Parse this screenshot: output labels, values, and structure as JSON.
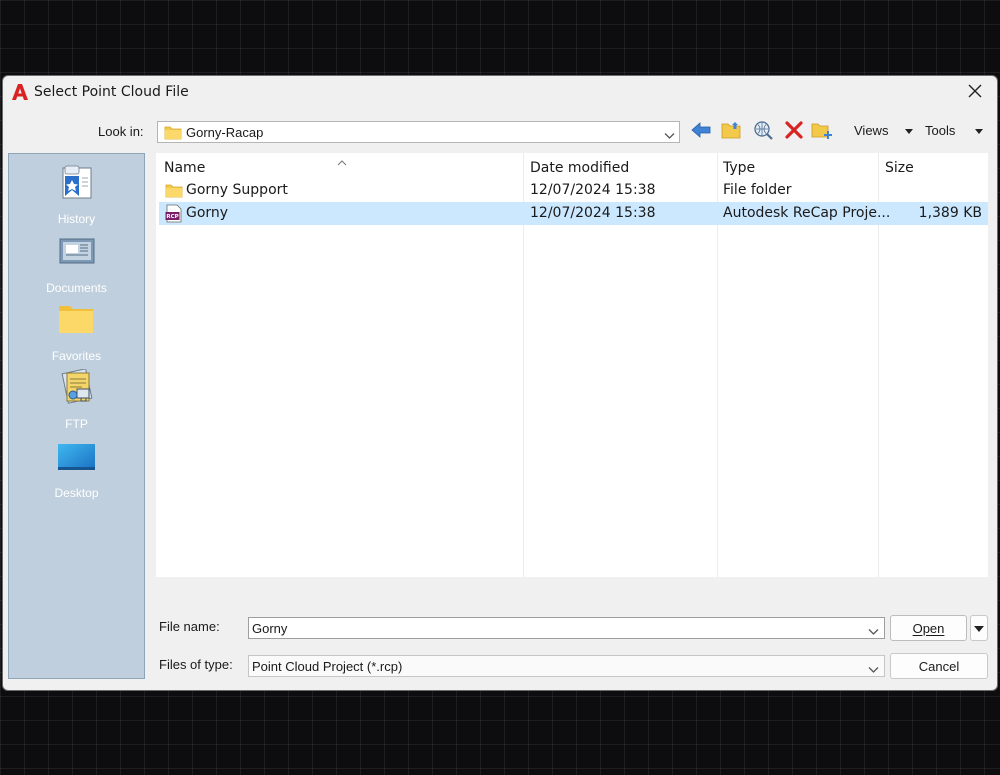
{
  "dialog": {
    "title": "Select Point Cloud File",
    "app_icon": "autocad-logo-icon",
    "close_icon": "close-icon"
  },
  "toolbar": {
    "look_in_label": "Look in:",
    "look_in_value": "Gorny-Racap",
    "icons": [
      "back-arrow-icon",
      "up-folder-icon",
      "search-web-icon",
      "delete-icon",
      "new-folder-icon"
    ],
    "views_label": "Views",
    "tools_label": "Tools"
  },
  "places": [
    {
      "label": "History",
      "icon": "history-icon"
    },
    {
      "label": "Documents",
      "icon": "documents-icon"
    },
    {
      "label": "Favorites",
      "icon": "favorites-folder-icon"
    },
    {
      "label": "FTP",
      "icon": "ftp-icon"
    },
    {
      "label": "Desktop",
      "icon": "desktop-icon"
    }
  ],
  "file_list": {
    "columns": [
      "Name",
      "Date modified",
      "Type",
      "Size"
    ],
    "rows": [
      {
        "name": "Gorny Support",
        "date": "12/07/2024 15:38",
        "type": "File folder",
        "size": "",
        "icon": "folder-icon",
        "selected": false
      },
      {
        "name": "Gorny",
        "date": "12/07/2024 15:38",
        "type": "Autodesk ReCap Proje...",
        "size": "1,389 KB",
        "icon": "rcp-file-icon",
        "selected": true
      }
    ]
  },
  "footer": {
    "file_name_label": "File name:",
    "file_name_value": "Gorny",
    "file_type_label": "Files of type:",
    "file_type_value": "Point Cloud Project (*.rcp)",
    "open_label": "Open",
    "cancel_label": "Cancel"
  },
  "colors": {
    "selection": "#cce8ff",
    "places_bg": "#bfcfdd",
    "accent_red": "#d92323"
  }
}
